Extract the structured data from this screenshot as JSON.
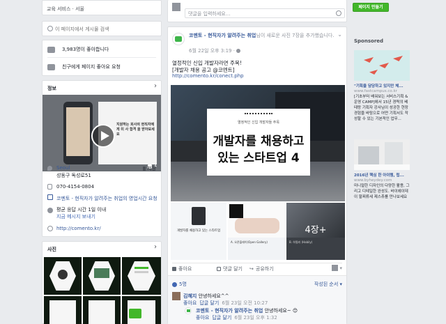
{
  "left": {
    "category": "교육 서비스 · 서울",
    "search_placeholder": "이 페이지에서 게시물 검색",
    "likes": "3,983명이 좋아합니다",
    "invite": "친구에게 페이지 좋아요 요청",
    "info": {
      "title": "정보",
      "video_text": "지원하는 회사의 현직자에게 미 사 합격 을 받아보세요",
      "video_count": "4",
      "address_line1": "Seoul",
      "address_line2": "성동구 독성로51",
      "save": "저장",
      "phone": "070-4154-0804",
      "hours": "코멘토 - 현직자가 알려주는 취업의 영업시간 요청",
      "response1": "평균 응답 시간 1일 이내",
      "response2": "지금 메시지 보내기",
      "website": "http://comento.kr/"
    },
    "photos_title": "사진"
  },
  "main": {
    "comment_placeholder": "댓글을 입력하세요...",
    "post": {
      "page_name": "코멘토 - 현직자가 알려주는 취업",
      "action": "님이 새로운 사진 7장을 추가했습니다.",
      "time": "6월 22일 오후 3:19 · ",
      "text1": "열정적인 신입 개발자라면 주목!",
      "text2": "[개발자 채용 공고 @코멘트]",
      "url": "http://comento.kr/conect.php",
      "image_small": "열정적인 신입 개발자들 주목",
      "image_title1": "개발자를 채용하고",
      "image_title2": "있는 스타트업 4",
      "thumb1_text": "개발자를 채용하고 있는 스타트업",
      "thumb2_label": "A. 오픈플레이(Open Gallery)",
      "thumb3_label": "B. 하필리 (Habily)",
      "more": "4장+",
      "like": "좋아요",
      "comment": "댓글 달기",
      "share": "공유하기",
      "reactions": "5명",
      "sort": "작성된 순서 ▾",
      "comments": [
        {
          "name": "김혜지",
          "text": "안녕하세요^^",
          "like": "좋아요",
          "reply": "답글 달기",
          "time": "6월 23일 오전 10:27"
        },
        {
          "name": "코멘토 - 현직자가 알려주는 취업",
          "text": "안녕하세요~ 😊",
          "like": "좋아요",
          "reply": "답글 달기",
          "time": "6월 23일 오후 1:32"
        }
      ]
    }
  },
  "right": {
    "create_page": "페이지 만들기",
    "sponsored": "Sponsored",
    "ad1": {
      "title": "\"기획을 담당하고 있지만 체...",
      "domain": "www.fastcampus.co.kr",
      "body": "[기초부터 배워보는 서비스기획 & 운영 CAMP]에서 15년 경력의 베테랑 기획자 강사님이 성공한 현장 경험을 바탕으로 어떤 기획서도 작성할 수 있는 기본적인 업무..."
    },
    "ad2": {
      "title": "2016년 핵심 한 아이템, 립...",
      "domain": "www.byheydey.com",
      "body": "미니멀한 디자인의 다양한 활용, 그리고 디테일한 완성도. 바이헤이데이 팔찌류세 제스츄를 만나보세요"
    }
  }
}
